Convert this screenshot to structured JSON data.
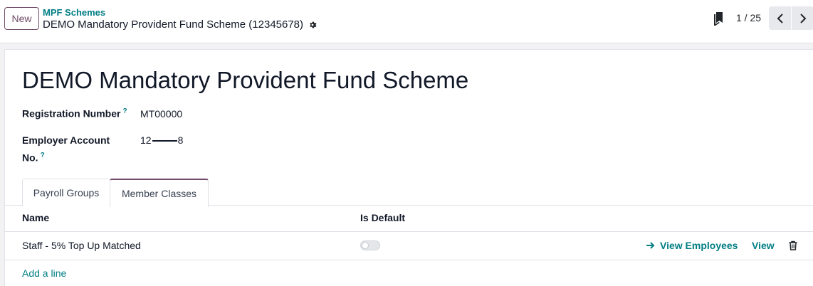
{
  "control_panel": {
    "new_label": "New",
    "breadcrumb_parent": "MPF Schemes",
    "breadcrumb_current": "DEMO Mandatory Provident Fund Scheme (12345678)",
    "pager": "1 / 25"
  },
  "form": {
    "title": "DEMO Mandatory Provident Fund Scheme",
    "registration_label": "Registration Number",
    "registration_value": "MT00000",
    "employer_label_line1": "Employer Account",
    "employer_label_line2": "No.",
    "employer_value_start": "12",
    "employer_value_end": "8",
    "help_mark": "?"
  },
  "tabs": [
    {
      "label": "Payroll Groups",
      "active": false
    },
    {
      "label": "Member Classes",
      "active": true
    }
  ],
  "table": {
    "columns": [
      "Name",
      "Is Default"
    ],
    "rows": [
      {
        "name": "Staff - 5% Top Up Matched",
        "is_default": false,
        "view_employees": "View Employees",
        "view": "View"
      }
    ],
    "add_line": "Add a line"
  },
  "colors": {
    "accent": "#714b67",
    "link": "#017e84"
  },
  "icons": [
    "gear-icon",
    "bookmark-icon",
    "chevron-left-icon",
    "chevron-right-icon",
    "arrow-right-icon",
    "trash-icon"
  ]
}
